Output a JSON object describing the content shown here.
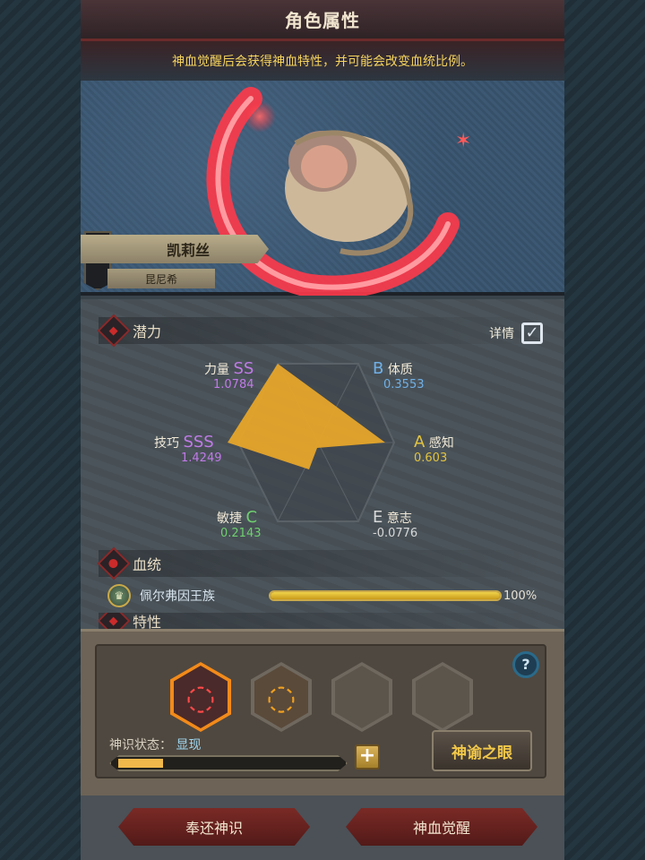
{
  "header": {
    "title": "角色属性",
    "info": "神血觉醒后会获得神血特性，并可能会改变血统比例。"
  },
  "character": {
    "name": "凯莉丝",
    "subtitle": "昆尼希"
  },
  "potential": {
    "section_label": "潜力",
    "detail_label": "详情",
    "detail_checked": true,
    "stats": [
      {
        "label": "力量",
        "grade": "SS",
        "value": "1.0784"
      },
      {
        "label": "体质",
        "grade": "B",
        "value": "0.3553"
      },
      {
        "label": "感知",
        "grade": "A",
        "value": "0.603"
      },
      {
        "label": "意志",
        "grade": "E",
        "value": "-0.0776"
      },
      {
        "label": "敏捷",
        "grade": "C",
        "value": "0.2143"
      },
      {
        "label": "技巧",
        "grade": "SSS",
        "value": "1.4249"
      }
    ]
  },
  "bloodline": {
    "section_label": "血统",
    "entries": [
      {
        "name": "佩尔弗因王族",
        "percent_text": "100%",
        "percent": 100
      }
    ],
    "next_section_label": "特性"
  },
  "divine": {
    "state_label": "神识状态：",
    "state_value": "显现",
    "progress": 0.2,
    "oracle_button": "神谕之眼",
    "help_icon": "?",
    "plus_icon": "+"
  },
  "actions": {
    "return_button": "奉还神识",
    "awaken_button": "神血觉醒"
  },
  "colors": {
    "accent_red": "#c92b2b",
    "radar_fill": "#e6a52a",
    "info_text": "#f4d35e"
  }
}
